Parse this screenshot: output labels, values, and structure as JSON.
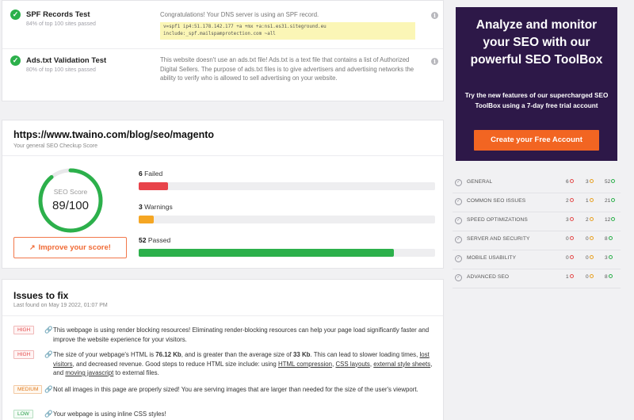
{
  "tests": [
    {
      "name": "SPF Records Test",
      "sub": "84% of top 100 sites passed",
      "desc": "Congratulations! Your DNS server is using an SPF record.",
      "code": "v=spf1 ip4:51.178.142.177 +a +mx +a:ns1.es31.siteground.eu include:_spf.mailspamprotection.com ~all"
    },
    {
      "name": "Ads.txt Validation Test",
      "sub": "80% of top 100 sites passed",
      "desc": "This website doesn't use an ads.txt file! Ads.txt is a text file that contains a list of Authorized Digital Sellers. The purpose of ads.txt files is to give advertisers and advertising networks the ability to verify who is allowed to sell advertising on your website."
    }
  ],
  "score": {
    "url": "https://www.twaino.com/blog/seo/magento",
    "subtitle": "Your general SEO Checkup Score",
    "label": "SEO Score",
    "value_text": "89/100",
    "value": 89,
    "improve_label": "Improve your score!",
    "metrics": [
      {
        "count": "6",
        "label": "Failed",
        "fraction": 0.1,
        "color": "#e8434a"
      },
      {
        "count": "3",
        "label": "Warnings",
        "fraction": 0.05,
        "color": "#f5a623"
      },
      {
        "count": "52",
        "label": "Passed",
        "fraction": 0.86,
        "color": "#2cb04b"
      }
    ]
  },
  "issues": {
    "title": "Issues to fix",
    "subtitle": "Last found on May 19 2022, 01:07 PM",
    "items": [
      {
        "severity": "HIGH",
        "text": "This webpage is using render blocking resources! Eliminating render-blocking resources can help your page load significantly faster and improve the website experience for your visitors."
      },
      {
        "severity": "HIGH",
        "parts": [
          "The size of your webpage's HTML is ",
          "76.12 Kb",
          ", and is greater than the average size of ",
          "33 Kb",
          ". This can lead to slower loading times, ",
          "lost visitors",
          ", and decreased revenue. Good steps to reduce HTML size include: using ",
          "HTML compression",
          ", ",
          "CSS layouts",
          ", ",
          "external style sheets",
          ", and ",
          "moving javascript",
          " to external files."
        ]
      },
      {
        "severity": "MEDIUM",
        "text": "Not all images in this page are properly sized! You are serving images that are larger than needed for the size of the user's viewport."
      },
      {
        "severity": "LOW",
        "text": "Your webpage is using inline CSS styles!"
      }
    ]
  },
  "promo": {
    "title": "Analyze and monitor your SEO with our powerful SEO ToolBox",
    "text": "Try the new features of our supercharged SEO ToolBox using a 7-day free trial account",
    "button": "Create your Free Account",
    "bg_color": "#2d1848",
    "button_color": "#f26522"
  },
  "categories": [
    {
      "name": "GENERAL",
      "failed": "6",
      "warnings": "3",
      "passed": "52"
    },
    {
      "name": "COMMON SEO ISSUES",
      "failed": "2",
      "warnings": "1",
      "passed": "21"
    },
    {
      "name": "SPEED OPTIMIZATIONS",
      "failed": "3",
      "warnings": "2",
      "passed": "12"
    },
    {
      "name": "SERVER AND SECURITY",
      "failed": "0",
      "warnings": "0",
      "passed": "8"
    },
    {
      "name": "MOBILE USABILITY",
      "failed": "0",
      "warnings": "0",
      "passed": "3"
    },
    {
      "name": "ADVANCED SEO",
      "failed": "1",
      "warnings": "0",
      "passed": "8"
    }
  ]
}
